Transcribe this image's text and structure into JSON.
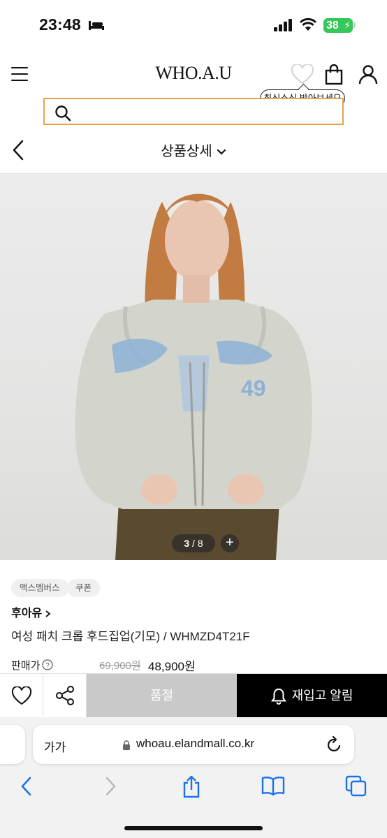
{
  "status": {
    "time": "23:48",
    "battery": "38"
  },
  "header": {
    "logo": "WHO.A.U",
    "tooltip": "최신소식 받아보세요"
  },
  "search": {
    "value": "",
    "placeholder": ""
  },
  "subheader": {
    "title": "상품상세"
  },
  "gallery": {
    "current": "3",
    "total": "8"
  },
  "tags": [
    "맥스멤버스",
    "쿠폰"
  ],
  "product": {
    "brand": "후아유",
    "name": "여성 패치 크롭 후드집업(기모) / WHMZD4T21F",
    "price_label": "판매가",
    "original_price": "69,900원",
    "sale_price": "48,900원"
  },
  "actions": {
    "soldout": "품절",
    "restock": "재입고 알림"
  },
  "browser": {
    "text_size": "가가",
    "url": "whoau.elandmall.co.kr"
  },
  "colors": {
    "search_border": "#e7a54a",
    "soldout_bg": "#c9c9c9",
    "restock_bg": "#000000",
    "battery": "#35c759"
  }
}
